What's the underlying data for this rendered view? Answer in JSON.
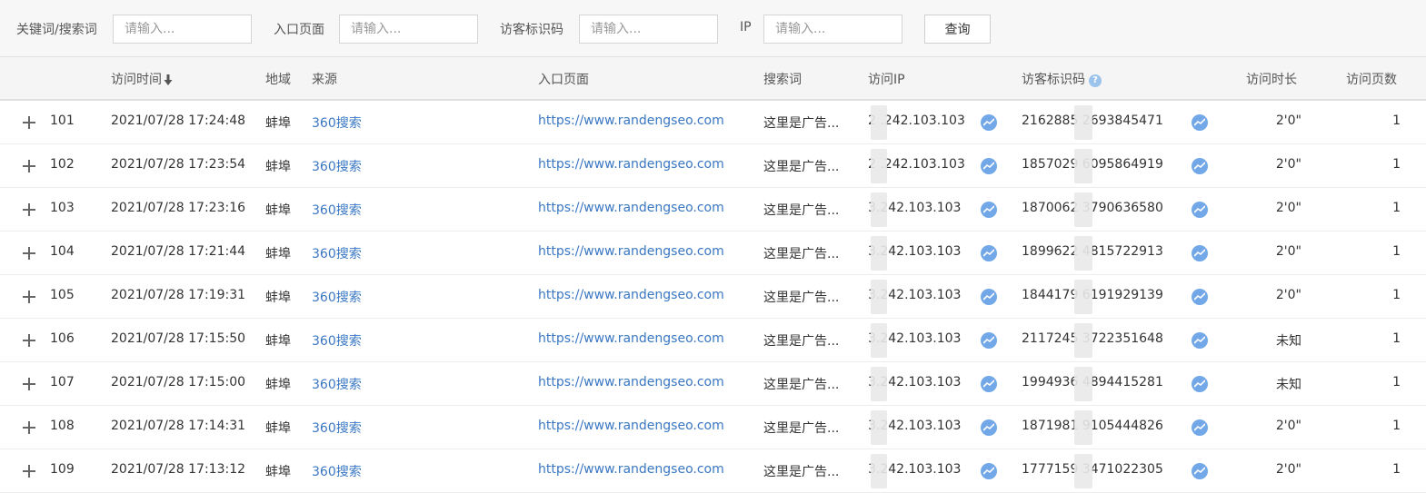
{
  "filters": {
    "keyword_label": "关键词/搜索词",
    "keyword_placeholder": "请输入...",
    "entry_label": "入口页面",
    "entry_placeholder": "请输入...",
    "visitor_label": "访客标识码",
    "visitor_placeholder": "请输入...",
    "ip_label": "IP",
    "ip_placeholder": "请输入...",
    "query_button": "查询"
  },
  "columns": {
    "time": "访问时间",
    "region": "地域",
    "source": "来源",
    "entry": "入口页面",
    "keyword": "搜索词",
    "ip": "访问IP",
    "visitor_id": "访客标识码",
    "duration": "访问时长",
    "pages": "访问页数"
  },
  "rows": [
    {
      "num": "101",
      "time": "2021/07/28 17:24:48",
      "region": "蚌埠",
      "source": "360搜索",
      "entry": "https://www.randengseo.com",
      "keyword": "这里是广告...",
      "ip": "2 .242.103.103",
      "visitor_id": "2162885 2693845471",
      "duration": "2'0\"",
      "pages": "1"
    },
    {
      "num": "102",
      "time": "2021/07/28 17:23:54",
      "region": "蚌埠",
      "source": "360搜索",
      "entry": "https://www.randengseo.com",
      "keyword": "这里是广告...",
      "ip": "2 .242.103.103",
      "visitor_id": "1857029 6095864919",
      "duration": "2'0\"",
      "pages": "1"
    },
    {
      "num": "103",
      "time": "2021/07/28 17:23:16",
      "region": "蚌埠",
      "source": "360搜索",
      "entry": "https://www.randengseo.com",
      "keyword": "这里是广告...",
      "ip": " 3.242.103.103",
      "visitor_id": "1870062 3790636580",
      "duration": "2'0\"",
      "pages": "1"
    },
    {
      "num": "104",
      "time": "2021/07/28 17:21:44",
      "region": "蚌埠",
      "source": "360搜索",
      "entry": "https://www.randengseo.com",
      "keyword": "这里是广告...",
      "ip": " 3.242.103.103",
      "visitor_id": "1899622 4815722913",
      "duration": "2'0\"",
      "pages": "1"
    },
    {
      "num": "105",
      "time": "2021/07/28 17:19:31",
      "region": "蚌埠",
      "source": "360搜索",
      "entry": "https://www.randengseo.com",
      "keyword": "这里是广告...",
      "ip": " 3.242.103.103",
      "visitor_id": "1844179 6191929139",
      "duration": "2'0\"",
      "pages": "1"
    },
    {
      "num": "106",
      "time": "2021/07/28 17:15:50",
      "region": "蚌埠",
      "source": "360搜索",
      "entry": "https://www.randengseo.com",
      "keyword": "这里是广告...",
      "ip": " 3.242.103.103",
      "visitor_id": "2117245 3722351648",
      "duration": "未知",
      "pages": "1"
    },
    {
      "num": "107",
      "time": "2021/07/28 17:15:00",
      "region": "蚌埠",
      "source": "360搜索",
      "entry": "https://www.randengseo.com",
      "keyword": "这里是广告...",
      "ip": " 3.242.103.103",
      "visitor_id": "1994936 4894415281",
      "duration": "未知",
      "pages": "1"
    },
    {
      "num": "108",
      "time": "2021/07/28 17:14:31",
      "region": "蚌埠",
      "source": "360搜索",
      "entry": "https://www.randengseo.com",
      "keyword": "这里是广告...",
      "ip": " 3.242.103.103",
      "visitor_id": "1871981 9105444826",
      "duration": "2'0\"",
      "pages": "1"
    },
    {
      "num": "109",
      "time": "2021/07/28 17:13:12",
      "region": "蚌埠",
      "source": "360搜索",
      "entry": "https://www.randengseo.com",
      "keyword": "这里是广告...",
      "ip": " 3.242.103.103",
      "visitor_id": "1777159 3471022305",
      "duration": "2'0\"",
      "pages": "1"
    }
  ],
  "colors": {
    "link": "#3a78c3",
    "trend_icon": "#72a8e8",
    "help_icon": "#9cc3ec"
  },
  "icons": {
    "sort": "arrow-down-icon",
    "expand": "plus-icon",
    "trend": "trend-icon",
    "help": "question-icon"
  }
}
